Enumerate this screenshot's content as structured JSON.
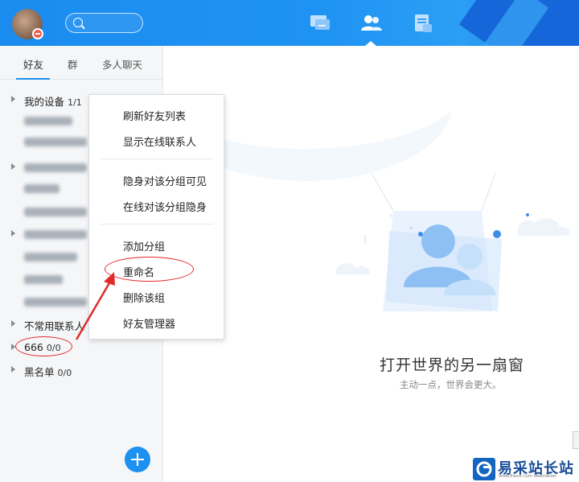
{
  "header": {
    "search": {
      "placeholder": ""
    },
    "tabs": [
      {
        "icon": "message-icon",
        "active": false
      },
      {
        "icon": "contacts-icon",
        "active": true
      },
      {
        "icon": "space-icon",
        "active": false
      }
    ]
  },
  "sidebar": {
    "tabs": [
      "好友",
      "群",
      "多人聊天"
    ],
    "groups": [
      {
        "label": "我的设备",
        "count": "1/1"
      },
      {
        "label": "不常用联系人",
        "count": ""
      },
      {
        "label": "666",
        "count": "0/0"
      },
      {
        "label": "黑名单",
        "count": "0/0"
      }
    ]
  },
  "context_menu": {
    "items": [
      "刷新好友列表",
      "显示在线联系人",
      "隐身对该分组可见",
      "在线对该分组隐身",
      "添加分组",
      "重命名",
      "删除该组",
      "好友管理器"
    ]
  },
  "main": {
    "tagline": "打开世界的另一扇窗",
    "subtagline": "主动一点，世界会更大。"
  },
  "watermark": {
    "text": "易采站长站",
    "sub": "Www.Easck.Com Webmaster"
  },
  "colors": {
    "accent": "#1e90f0",
    "annotation": "#e12b2b"
  }
}
